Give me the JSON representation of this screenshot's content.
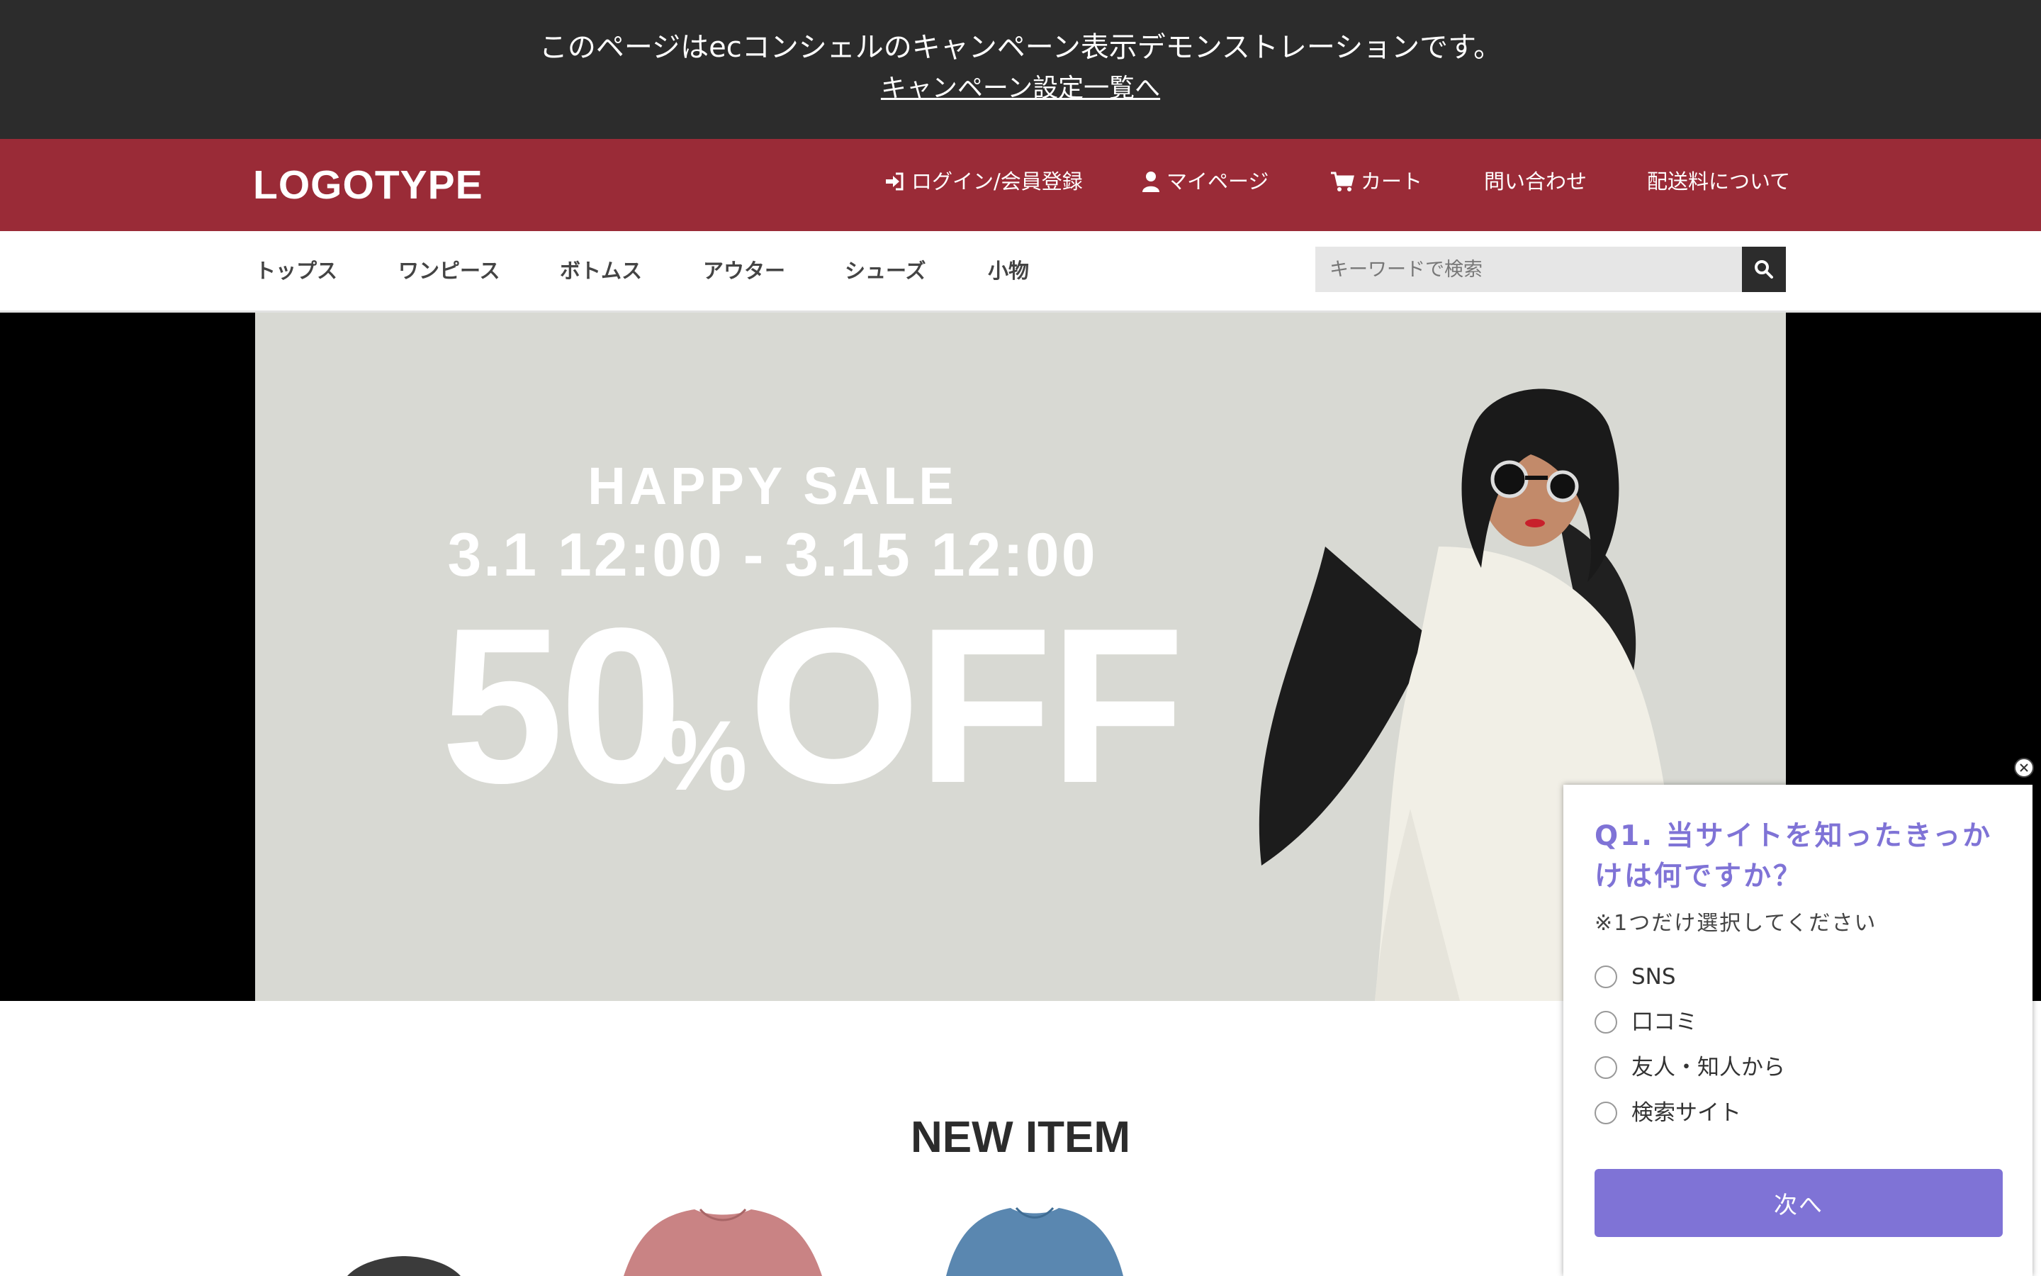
{
  "banner": {
    "message": "このページはecコンシェルのキャンペーン表示デモンストレーションです。",
    "link": "キャンペーン設定一覧へ"
  },
  "header": {
    "logo": "LOGOTYPE",
    "nav": [
      {
        "label": "ログイン/会員登録",
        "icon": "sign-in-icon"
      },
      {
        "label": "マイページ",
        "icon": "user-icon"
      },
      {
        "label": "カート",
        "icon": "cart-icon"
      },
      {
        "label": "問い合わせ"
      },
      {
        "label": "配送料について"
      }
    ]
  },
  "categories": [
    "トップス",
    "ワンピース",
    "ボトムス",
    "アウター",
    "シューズ",
    "小物"
  ],
  "search": {
    "placeholder": "キーワードで検索",
    "icon": "search-icon"
  },
  "hero": {
    "line1": "HAPPY SALE",
    "line2": "3.1 12:00 - 3.15 12:00",
    "discount_number": "50",
    "discount_percent": "%",
    "discount_word": "OFF"
  },
  "section": {
    "title": "NEW ITEM"
  },
  "survey": {
    "question": "Q1. 当サイトを知ったきっかけは何ですか？",
    "note": "※1つだけ選択してください",
    "options": [
      "SNS",
      "口コミ",
      "友人・知人から",
      "検索サイト"
    ],
    "next_label": "次へ",
    "close_icon": "close-icon"
  },
  "colors": {
    "top_banner": "#2c2c2c",
    "header": "#9a2b37",
    "hero_bg": "#d8d9d3",
    "survey_accent": "#7f73d6"
  }
}
